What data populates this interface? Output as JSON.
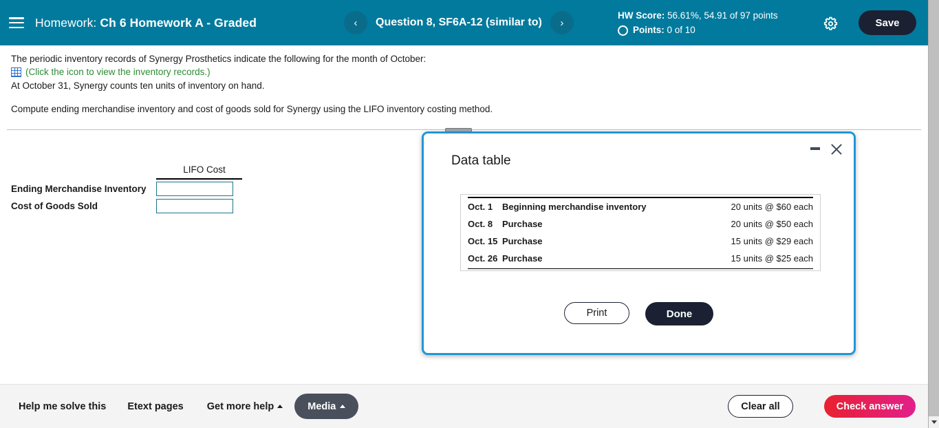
{
  "header": {
    "menu_icon": "hamburger-icon",
    "homework_label": "Homework:",
    "homework_name": "Ch 6 Homework A - Graded",
    "prev_icon": "‹",
    "next_icon": "›",
    "question_label": "Question 8, SF6A-12 (similar to)",
    "hw_score_label": "HW Score:",
    "hw_score_value": "56.61%, 54.91 of 97 points",
    "points_label": "Points:",
    "points_value": "0 of 10",
    "settings_icon": "gear-icon",
    "save_label": "Save",
    "bg_color": "#027a9d",
    "save_bg": "#1b2133"
  },
  "question": {
    "line1": "The periodic inventory records of Synergy Prosthetics indicate the following for the month of October:",
    "icon_name": "spreadsheet-grid-icon",
    "link_text": "(Click the icon to view the inventory records.)",
    "link_color": "#2e8b36",
    "line2": "At October 31, Synergy counts ten units of inventory on hand.",
    "line3": "Compute ending merchandise inventory and cost of goods sold for Synergy using the LIFO inventory costing method."
  },
  "answer_table": {
    "column_header": "LIFO Cost",
    "rows": [
      {
        "label": "Ending Merchandise Inventory",
        "value": "",
        "placeholder": ""
      },
      {
        "label": "Cost of Goods Sold",
        "value": "",
        "placeholder": ""
      }
    ],
    "input_border_color": "#17758e"
  },
  "modal": {
    "title": "Data table",
    "minimize_icon": "minimize-icon",
    "close_icon": "close-icon",
    "drag_handle_icon": "drag-handle-icon",
    "border_color": "#2196d6",
    "rows": [
      {
        "date": "Oct. 1",
        "description": "Beginning merchandise inventory",
        "quantity": "20 units @ $60 each"
      },
      {
        "date": "Oct. 8",
        "description": "Purchase",
        "quantity": "20 units @ $50 each"
      },
      {
        "date": "Oct. 15",
        "description": "Purchase",
        "quantity": "15 units @ $29 each"
      },
      {
        "date": "Oct. 26",
        "description": "Purchase",
        "quantity": "15 units @ $25 each"
      }
    ],
    "print_label": "Print",
    "done_label": "Done"
  },
  "bottombar": {
    "help_me_solve": "Help me solve this",
    "etext_pages": "Etext pages",
    "get_more_help": "Get more help",
    "media": "Media",
    "clear_all": "Clear all",
    "check_answer": "Check answer",
    "check_answer_gradient_from": "#e8212f",
    "check_answer_gradient_to": "#e21f8c"
  },
  "scrollbar": {
    "down_arrow_icon": "chevron-down-icon"
  }
}
